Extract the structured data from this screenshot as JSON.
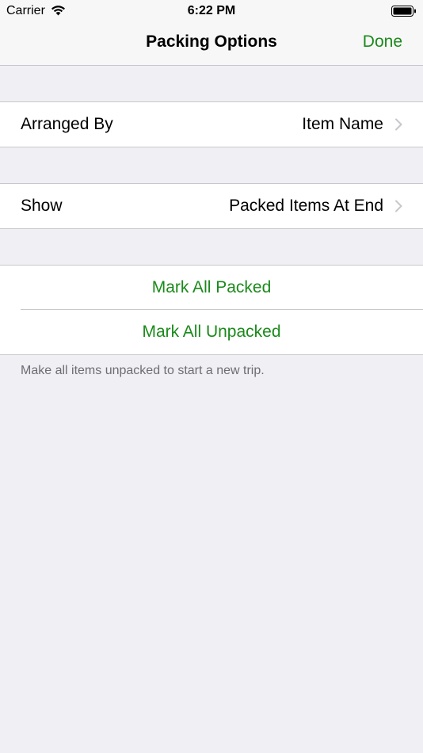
{
  "status_bar": {
    "carrier": "Carrier",
    "time": "6:22 PM",
    "icons": [
      "wifi-icon",
      "battery-icon"
    ]
  },
  "nav": {
    "title": "Packing Options",
    "done_label": "Done"
  },
  "sections": {
    "arranged_by": {
      "label": "Arranged By",
      "value": "Item Name"
    },
    "show": {
      "label": "Show",
      "value": "Packed Items At End"
    },
    "actions": {
      "mark_all_packed": "Mark All Packed",
      "mark_all_unpacked": "Mark All Unpacked"
    }
  },
  "footer_note": "Make all items unpacked to start a new trip.",
  "colors": {
    "accent": "#1a8a1a",
    "background": "#efeff4",
    "separator": "#c8c7cc",
    "secondary_text": "#6d6d72"
  }
}
